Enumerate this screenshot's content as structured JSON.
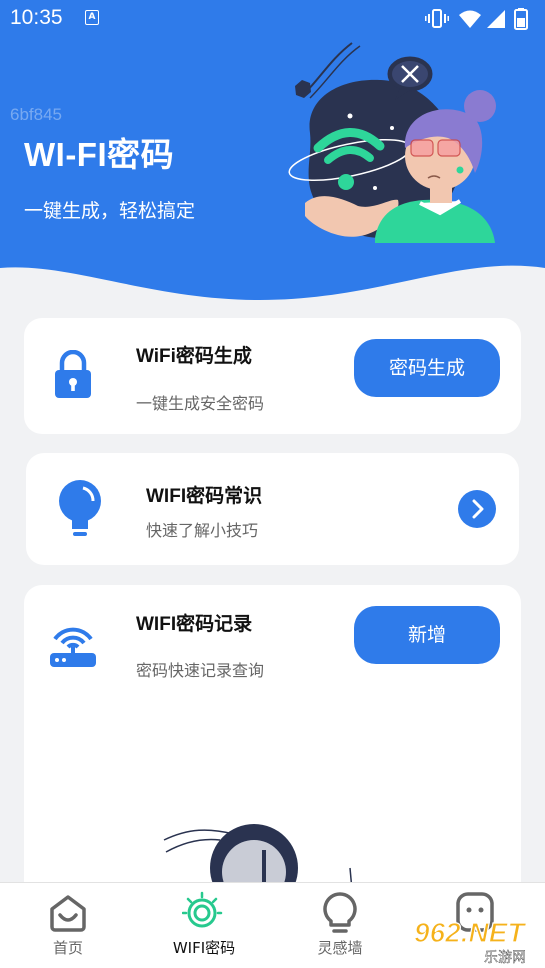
{
  "status_bar": {
    "time": "10:35",
    "notification_badge": "A"
  },
  "header": {
    "watermark_code": "6bf845",
    "title": "WI-FI密码",
    "subtitle": "一键生成，轻松搞定",
    "accent_color": "#2f7bea"
  },
  "cards": {
    "generate": {
      "title": "WiFi密码生成",
      "description": "一键生成安全密码",
      "button_label": "密码生成",
      "icon": "lock-icon"
    },
    "knowledge": {
      "title": "WIFI密码常识",
      "description": "快速了解小技巧",
      "icon": "bulb-icon"
    },
    "records": {
      "title": "WIFI密码记录",
      "description": "密码快速记录查询",
      "button_label": "新增",
      "icon": "router-icon"
    }
  },
  "bottom_nav": {
    "items": [
      {
        "label": "首页",
        "icon": "home-icon",
        "active": false
      },
      {
        "label": "WIFI密码",
        "icon": "wifi-icon",
        "active": true
      },
      {
        "label": "灵感墙",
        "icon": "bulb-icon",
        "active": false
      },
      {
        "label": "",
        "icon": "face-icon",
        "active": false
      }
    ]
  },
  "watermark": {
    "brand": "962.NET",
    "sub": "乐游网"
  }
}
